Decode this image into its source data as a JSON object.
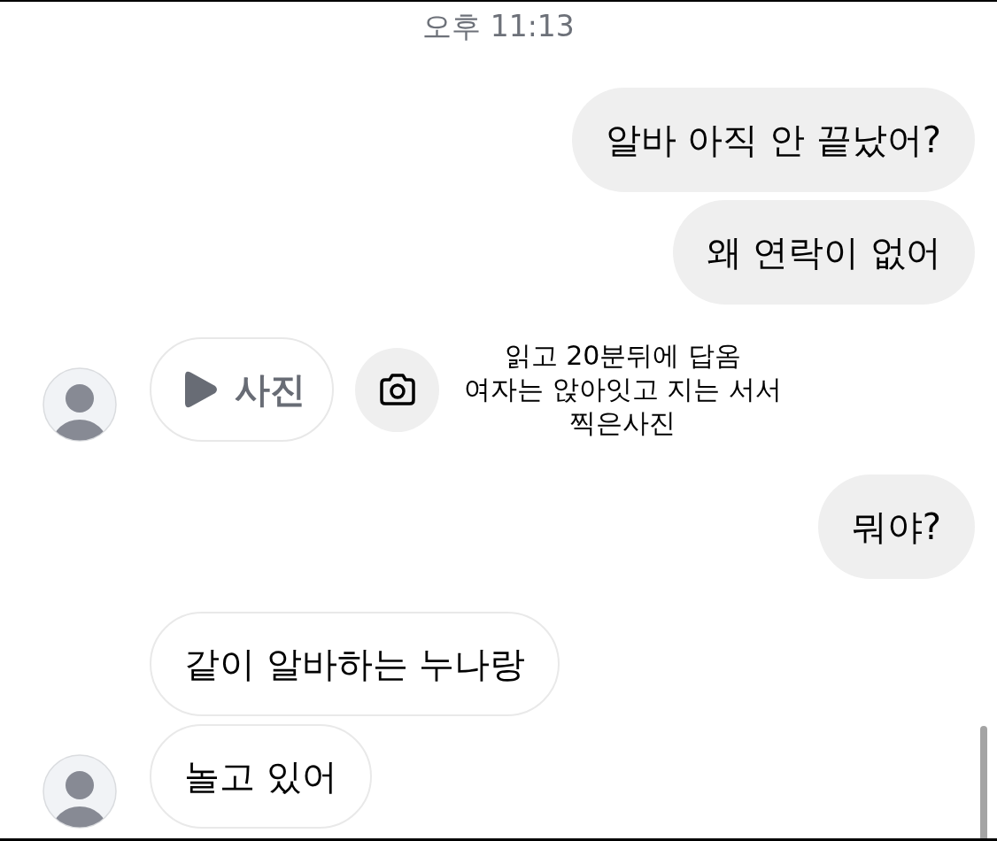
{
  "timestamp": "오후 11:13",
  "messages": [
    {
      "kind": "outgoing",
      "text": "알바 아직 안 끝났어?"
    },
    {
      "kind": "outgoing",
      "text": "왜 연락이 없어"
    },
    {
      "kind": "photo",
      "label": "사진",
      "avatar": true,
      "annotation": "읽고 20분뒤에 답옴\n여자는 앉아잇고 지는 서서\n찍은사진"
    },
    {
      "kind": "outgoing",
      "text": "뭐야?"
    },
    {
      "kind": "incoming",
      "text": "같이 알바하는 누나랑",
      "avatar": false
    },
    {
      "kind": "incoming",
      "text": "놀고 있어",
      "avatar": true
    }
  ]
}
